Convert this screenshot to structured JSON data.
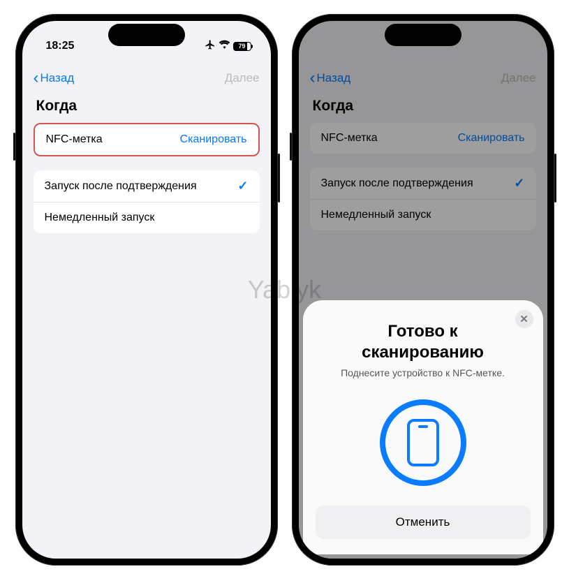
{
  "watermark": "Yablyk",
  "status": {
    "time": "18:25",
    "battery": "79"
  },
  "nav": {
    "back": "Назад",
    "next": "Далее"
  },
  "section_title": "Когда",
  "nfc_row": {
    "label": "NFC-метка",
    "action": "Сканировать"
  },
  "options": {
    "confirm": "Запуск после подтверждения",
    "immediate": "Немедленный запуск"
  },
  "sheet": {
    "title_line1": "Готово к",
    "title_line2": "сканированию",
    "subtitle": "Поднесите устройство к NFC-метке.",
    "cancel": "Отменить"
  }
}
